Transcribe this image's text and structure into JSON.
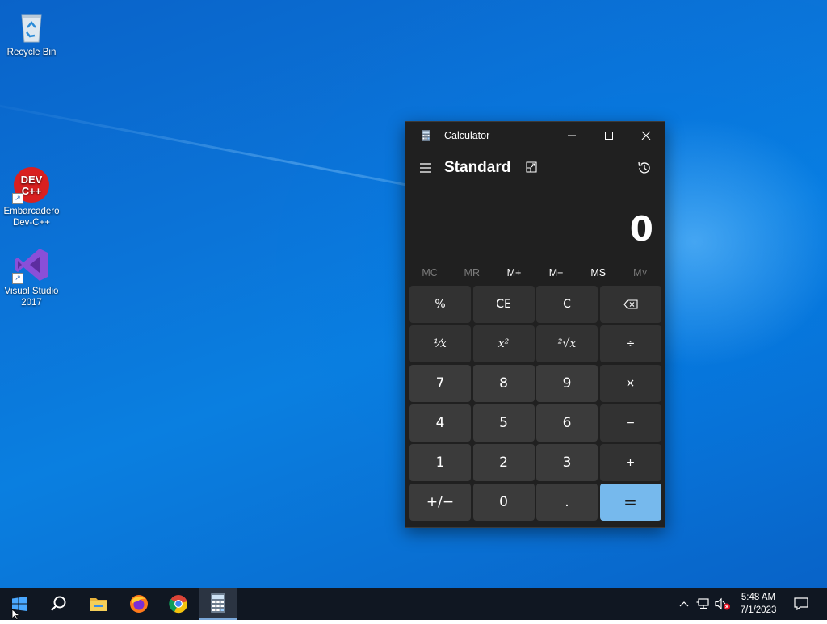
{
  "desktop": {
    "icons": [
      {
        "label": "Recycle Bin",
        "icon": "recycle-bin-icon"
      },
      {
        "label": "Embarcadero Dev-C++",
        "icon": "devcpp-icon",
        "badge_text": "DEV C++"
      },
      {
        "label": "Visual Studio 2017",
        "icon": "visual-studio-icon"
      }
    ]
  },
  "calculator": {
    "window_title": "Calculator",
    "mode": "Standard",
    "display_value": "0",
    "memory": [
      {
        "label": "MC",
        "enabled": false
      },
      {
        "label": "MR",
        "enabled": false
      },
      {
        "label": "M+",
        "enabled": true
      },
      {
        "label": "M−",
        "enabled": true
      },
      {
        "label": "MS",
        "enabled": true
      },
      {
        "label": "M˅",
        "enabled": false
      }
    ],
    "keys": {
      "percent": "%",
      "ce": "CE",
      "c": "C",
      "reciprocal": "⅟x",
      "square": "x²",
      "sqrt": "²√x",
      "divide": "÷",
      "seven": "7",
      "eight": "8",
      "nine": "9",
      "multiply": "×",
      "four": "4",
      "five": "5",
      "six": "6",
      "minus": "−",
      "one": "1",
      "two": "2",
      "three": "3",
      "plus": "+",
      "negate": "+/−",
      "zero": "0",
      "decimal": ".",
      "equals": "="
    },
    "colors": {
      "background": "#202020",
      "key": "#3b3b3b",
      "equals": "#76b9ed"
    }
  },
  "taskbar": {
    "apps": [
      "start-icon",
      "search-icon",
      "file-explorer-icon",
      "firefox-icon",
      "chrome-icon",
      "calculator-icon"
    ],
    "clock": {
      "time": "5:48 AM",
      "date": "7/1/2023"
    }
  }
}
